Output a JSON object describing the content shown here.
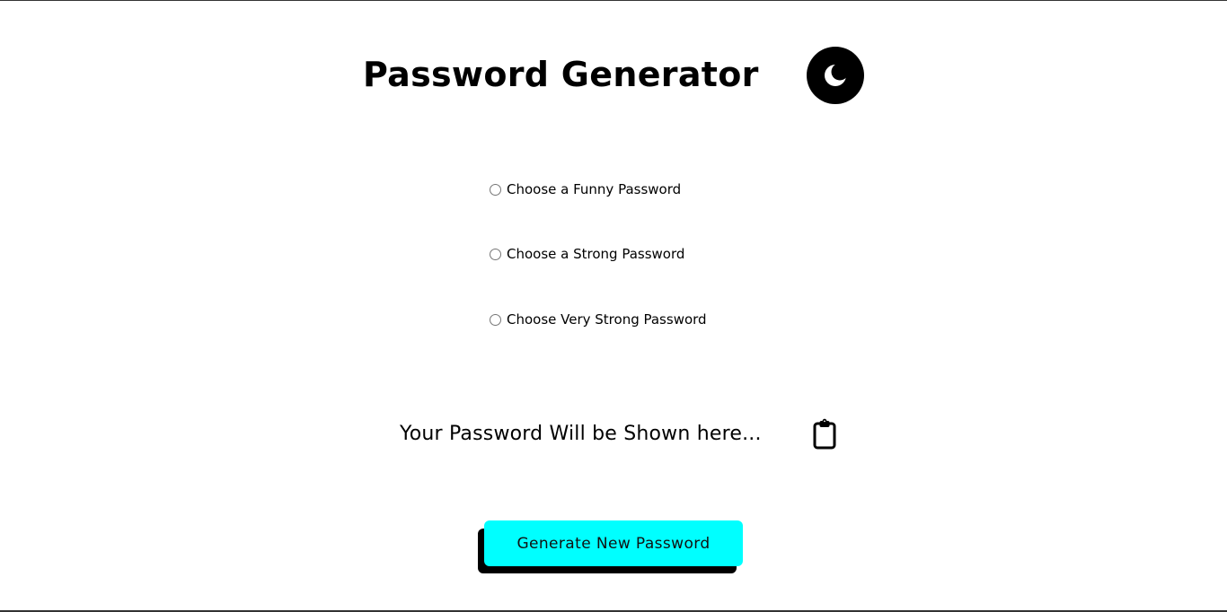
{
  "header": {
    "title": "Password Generator",
    "theme_toggle_icon": "moon-icon"
  },
  "options": [
    {
      "label": "Choose a Funny Password",
      "selected": false
    },
    {
      "label": "Choose a Strong Password",
      "selected": false
    },
    {
      "label": "Choose Very Strong Password",
      "selected": false
    }
  ],
  "output": {
    "placeholder_text": "Your Password Will be Shown here...",
    "copy_icon": "clipboard-icon"
  },
  "actions": {
    "generate_label": "Generate New Password"
  },
  "colors": {
    "accent": "#00ffff",
    "text": "#000000",
    "background": "#ffffff",
    "button_shadow": "#000000"
  }
}
